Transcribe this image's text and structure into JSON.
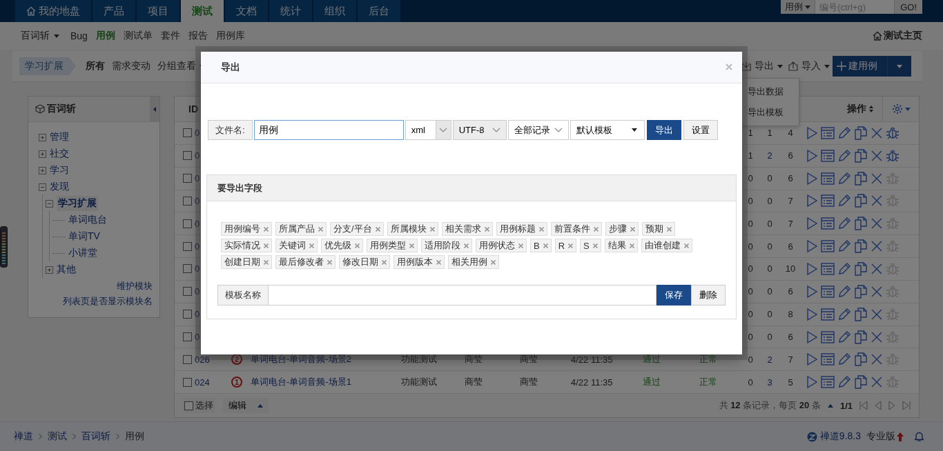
{
  "top_nav": {
    "tabs": [
      {
        "label": "我的地盘",
        "kind": "home",
        "selected": false
      },
      {
        "label": "产品",
        "kind": "plain",
        "selected": false
      },
      {
        "label": "项目",
        "kind": "plain",
        "selected": false
      },
      {
        "label": "测试",
        "kind": "plain",
        "selected": true
      },
      {
        "label": "文档",
        "kind": "plain",
        "selected": false
      },
      {
        "label": "统计",
        "kind": "plain",
        "selected": false
      },
      {
        "label": "组织",
        "kind": "plain",
        "selected": false
      },
      {
        "label": "后台",
        "kind": "plain",
        "selected": false
      }
    ],
    "search": {
      "scope": "用例",
      "placeholder": "编号(ctrl+g)",
      "button": "GO!"
    }
  },
  "sub_nav": {
    "product": "百词斩",
    "items": [
      {
        "label": "Bug",
        "selected": false
      },
      {
        "label": "用例",
        "selected": true
      },
      {
        "label": "测试单",
        "selected": false
      },
      {
        "label": "套件",
        "selected": false
      },
      {
        "label": "报告",
        "selected": false
      },
      {
        "label": "用例库",
        "selected": false
      }
    ],
    "home_link": "测试主页"
  },
  "toolbar": {
    "module": "学习扩展",
    "filters": [
      {
        "label": "所有",
        "selected": true
      },
      {
        "label": "需求变动",
        "selected": false
      }
    ],
    "group_menu": "分组查看",
    "export": "导出",
    "import": "导入",
    "create": "建用例"
  },
  "export_menu": {
    "items": [
      "导出数据",
      "导出模板"
    ]
  },
  "module_tree": {
    "title": "百词斩",
    "items": [
      {
        "label": "管理",
        "expanded": false,
        "selected": false
      },
      {
        "label": "社交",
        "expanded": false,
        "selected": false
      },
      {
        "label": "学习",
        "expanded": false,
        "selected": false
      },
      {
        "label": "发现",
        "expanded": true,
        "selected": false,
        "children": [
          {
            "label": "学习扩展",
            "expanded": true,
            "selected": true,
            "children": [
              {
                "label": "单词电台",
                "selected": false
              },
              {
                "label": "单词TV",
                "selected": false
              },
              {
                "label": "小讲堂",
                "selected": false
              }
            ]
          },
          {
            "label": "其他",
            "expanded": false,
            "selected": false
          }
        ]
      }
    ],
    "links": [
      "维护模块",
      "列表页是否显示模块名"
    ]
  },
  "table": {
    "header": {
      "id": "ID",
      "actions": "操作"
    },
    "rows": [
      {
        "id": "0",
        "checked": false,
        "counts": [
          "1",
          "1",
          "4"
        ],
        "count_link": false,
        "bug_enabled": true
      },
      {
        "id": "0",
        "checked": false,
        "counts": [
          "1",
          "2",
          "6"
        ],
        "count_link": true,
        "bug_enabled": true
      },
      {
        "id": "0",
        "checked": false,
        "counts": [
          "0",
          "0",
          "6"
        ],
        "count_link": false,
        "bug_enabled": false
      },
      {
        "id": "0",
        "checked": false,
        "counts": [
          "0",
          "0",
          "7"
        ],
        "count_link": false,
        "bug_enabled": false
      },
      {
        "id": "0",
        "checked": false,
        "counts": [
          "0",
          "0",
          "7"
        ],
        "count_link": false,
        "bug_enabled": false
      },
      {
        "id": "0",
        "checked": false,
        "counts": [
          "0",
          "0",
          "6"
        ],
        "count_link": false,
        "bug_enabled": false
      },
      {
        "id": "0",
        "checked": false,
        "counts": [
          "0",
          "0",
          "10"
        ],
        "count_link": false,
        "bug_enabled": false
      },
      {
        "id": "0",
        "checked": false,
        "counts": [
          "0",
          "0",
          "6"
        ],
        "count_link": false,
        "bug_enabled": false
      },
      {
        "id": "0",
        "checked": false,
        "counts": [
          "0",
          "0",
          "8"
        ],
        "count_link": false,
        "bug_enabled": false
      },
      {
        "id": "0",
        "checked": false,
        "counts": [
          "0",
          "0",
          "6"
        ],
        "count_link": false,
        "bug_enabled": false
      },
      {
        "id": "026",
        "checked": false,
        "priority": "2",
        "title": "单词电台-单词音频-场景2",
        "cells": [
          {
            "text": "功能测试",
            "kind": "plain"
          },
          {
            "text": "商莹",
            "kind": "plain"
          },
          {
            "text": "商莹",
            "kind": "plain"
          },
          {
            "text": "4/22 11:35",
            "kind": "plain"
          },
          {
            "text": "通过",
            "kind": "success"
          },
          {
            "text": "正常",
            "kind": "success"
          }
        ],
        "counts": [
          "0",
          "2",
          "7"
        ],
        "count_link": true,
        "bug_enabled": false
      },
      {
        "id": "024",
        "checked": false,
        "priority": "1",
        "title": "单词电台-单词音频-场景1",
        "cells": [
          {
            "text": "功能测试",
            "kind": "plain"
          },
          {
            "text": "商莹",
            "kind": "plain"
          },
          {
            "text": "商莹",
            "kind": "plain"
          },
          {
            "text": "4/22 11:35",
            "kind": "plain"
          },
          {
            "text": "通过",
            "kind": "success"
          },
          {
            "text": "正常",
            "kind": "success"
          }
        ],
        "counts": [
          "0",
          "3",
          "5"
        ],
        "count_link": true,
        "bug_enabled": false
      }
    ],
    "footer": {
      "select_all": "选择",
      "select_all_checked": false,
      "edit": "编辑",
      "summary": "共 **12** 条记录，每页 **20** 条",
      "page": "1/1"
    }
  },
  "breadcrumb": [
    {
      "label": "禅道",
      "link": true
    },
    {
      "label": "测试",
      "link": true
    },
    {
      "label": "百词斩",
      "link": true
    },
    {
      "label": "用例",
      "link": false
    }
  ],
  "version": {
    "label": "禅道9.8.3",
    "edition": "专业版"
  },
  "modal": {
    "title": "导出",
    "file_label": "文件名:",
    "file_name": "用例",
    "selects": [
      {
        "value": "xml",
        "kind": "boxed",
        "disabled": false
      },
      {
        "value": "UTF-8",
        "kind": "chevron",
        "disabled": true
      },
      {
        "value": "全部记录",
        "kind": "chevron",
        "disabled": false
      },
      {
        "value": "默认模板",
        "kind": "caret",
        "disabled": false
      }
    ],
    "buttons": [
      {
        "label": "导出",
        "kind": "primary"
      },
      {
        "label": "设置",
        "kind": "default"
      }
    ],
    "fields_title": "要导出字段",
    "fields": [
      "用例编号",
      "所属产品",
      "分支/平台",
      "所属模块",
      "相关需求",
      "用例标题",
      "前置条件",
      "步骤",
      "预期",
      "实际情况",
      "关键词",
      "优先级",
      "用例类型",
      "适用阶段",
      "用例状态",
      "B",
      "R",
      "S",
      "结果",
      "由谁创建",
      "创建日期",
      "最后修改者",
      "修改日期",
      "用例版本",
      "相关用例"
    ],
    "template_label": "模板名称",
    "template_buttons": [
      {
        "label": "保存",
        "kind": "primary"
      },
      {
        "label": "删除",
        "kind": "default"
      }
    ]
  }
}
